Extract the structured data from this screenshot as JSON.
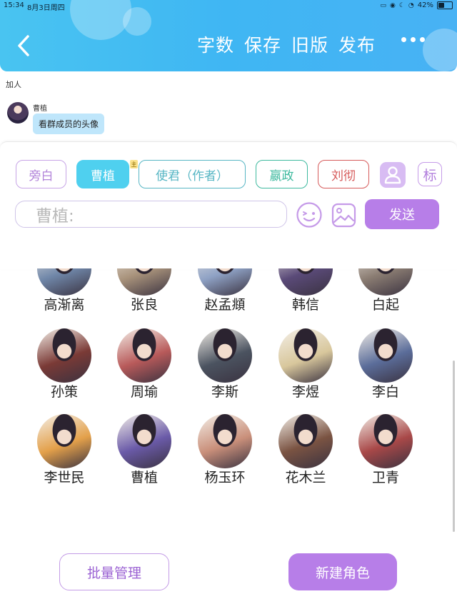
{
  "status_bar": {
    "time": "15:34",
    "date": "8月3日周四",
    "battery": "42%",
    "battery_level": 0.42
  },
  "header": {
    "menu": [
      {
        "label": "字数"
      },
      {
        "label": "保存"
      },
      {
        "label": "旧版"
      },
      {
        "label": "发布"
      }
    ],
    "more_icon": "more-dots-icon",
    "back_icon": "chevron-left-icon"
  },
  "chat": {
    "notice": "加人",
    "message": {
      "sender": "曹植",
      "text": "看群成员的头像"
    }
  },
  "roles_bar": {
    "tabs": [
      {
        "label": "旁白"
      },
      {
        "label": "曹植"
      },
      {
        "label": "使君（作者）"
      },
      {
        "label": "嬴政"
      },
      {
        "label": "刘彻"
      }
    ],
    "owner_badge": "主",
    "tag_button": "标"
  },
  "composer": {
    "placeholder": "曹植:",
    "send_label": "发送"
  },
  "role_grid": {
    "items": [
      {
        "name": "高渐离",
        "color": "#6f86a8"
      },
      {
        "name": "张良",
        "color": "#a7917a"
      },
      {
        "name": "赵孟頫",
        "color": "#8ea1c4"
      },
      {
        "name": "韩信",
        "color": "#5a4a78"
      },
      {
        "name": "白起",
        "color": "#8a7c72"
      },
      {
        "name": "孙策",
        "color": "#7a3a36"
      },
      {
        "name": "周瑜",
        "color": "#b85a5a"
      },
      {
        "name": "李斯",
        "color": "#4b5360"
      },
      {
        "name": "李煜",
        "color": "#d8c79c"
      },
      {
        "name": "李白",
        "color": "#5b6d9a"
      },
      {
        "name": "李世民",
        "color": "#e3a04a"
      },
      {
        "name": "曹植",
        "color": "#6a5aa8"
      },
      {
        "name": "杨玉环",
        "color": "#c98f7a"
      },
      {
        "name": "花木兰",
        "color": "#7a5342"
      },
      {
        "name": "卫青",
        "color": "#a84848"
      }
    ]
  },
  "footer": {
    "batch_label": "批量管理",
    "new_label": "新建角色"
  }
}
